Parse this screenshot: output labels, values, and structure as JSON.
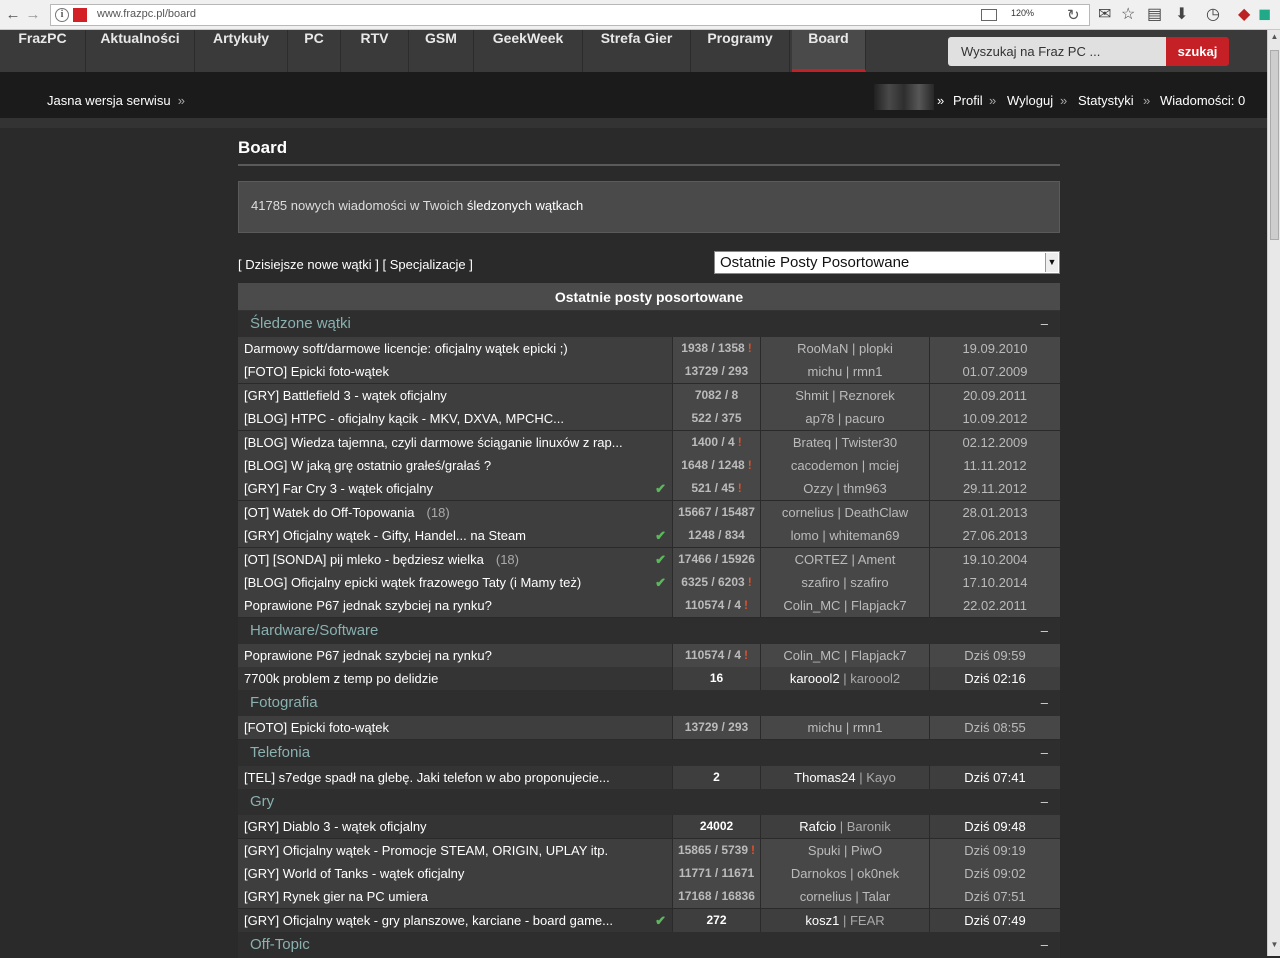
{
  "browser": {
    "url": "www.frazpc.pl/board",
    "zoom": "120%"
  },
  "nav": {
    "items": [
      "FrazPC",
      "Aktualności",
      "Artykuły",
      "PC",
      "RTV",
      "GSM",
      "GeekWeek",
      "Strefa Gier",
      "Programy",
      "Board"
    ],
    "active": "Board",
    "search_placeholder": "Wyszukaj na Fraz PC ...",
    "search_button": "szukaj"
  },
  "subbar": {
    "light_version": "Jasna wersja serwisu",
    "profile": "Profil",
    "logout": "Wyloguj",
    "stats": "Statystyki",
    "messages": "Wiadomości: 0",
    "separator": "»"
  },
  "board": {
    "title": "Board",
    "new_count": "41785",
    "new_text": "nowych wiadomości w Twoich",
    "followed_link": "śledzonych wątkach",
    "todays_link": "Dzisiejsze nowe wątki",
    "spec_link": "Specjalizacje",
    "sort_select": "Ostatnie Posty Posortowane",
    "table_header": "Ostatnie posty posortowane"
  },
  "sections": [
    {
      "name": "Śledzone wątki",
      "rows": [
        {
          "title": "Darmowy soft/darmowe licencje: oficjalny wątek epicki ;)",
          "count": "1938 / 1358",
          "excl": true,
          "users": "RooMaN | plopki",
          "date": "19.09.2010"
        },
        {
          "title": "[FOTO] Epicki foto-wątek",
          "count": "13729 / 293",
          "users": "michu | rmn1",
          "date": "01.07.2009"
        },
        {
          "title": "[GRY] Battlefield 3 - wątek oficjalny",
          "count": "7082 / 8",
          "users": "Shmit | Reznorek",
          "date": "20.09.2011"
        },
        {
          "title": "[BLOG] HTPC - oficjalny kącik - MKV, DXVA, MPCHC...",
          "count": "522 / 375",
          "users": "ap78 | pacuro",
          "date": "10.09.2012"
        },
        {
          "title": "[BLOG] Wiedza tajemna, czyli darmowe ściąganie linuxów z rap...",
          "count": "1400 / 4",
          "excl": true,
          "users": "Brateq | Twister30",
          "date": "02.12.2009"
        },
        {
          "title": "[BLOG] W jaką grę ostatnio grałeś/grałaś ?",
          "count": "1648 / 1248",
          "excl": true,
          "users": "cacodemon | mciej",
          "date": "11.11.2012"
        },
        {
          "title": "[GRY] Far Cry 3 - wątek oficjalny",
          "check": true,
          "count": "521 / 45",
          "excl": true,
          "users": "Ozzy | thm963",
          "date": "29.11.2012"
        },
        {
          "title": "[OT] Watek do Off-Topowania",
          "pages": "(18)",
          "count": "15667 / 15487",
          "users": "cornelius | DeathClaw",
          "date": "28.01.2013"
        },
        {
          "title": "[GRY] Oficjalny wątek - Gifty, Handel... na Steam",
          "check": true,
          "count": "1248 / 834",
          "users": "lomo | whiteman69",
          "date": "27.06.2013"
        },
        {
          "title": "[OT] [SONDA] pij mleko - będziesz wielka",
          "pages": "(18)",
          "check": true,
          "count": "17466 / 15926",
          "users": "CORTEZ | Ament",
          "date": "19.10.2004"
        },
        {
          "title": "[BLOG] Oficjalny epicki wątek frazowego Taty (i Mamy też)",
          "check": true,
          "count": "6325 / 6203",
          "excl": true,
          "users": "szafiro | szafiro",
          "date": "17.10.2014"
        },
        {
          "title": "Poprawione P67 jednak szybciej na rynku?",
          "count": "110574 / 4",
          "excl": true,
          "users": "Colin_MC | Flapjack7",
          "date": "22.02.2011"
        }
      ]
    },
    {
      "name": "Hardware/Software",
      "rows": [
        {
          "title": "Poprawione P67 jednak szybciej na rynku?",
          "count": "110574 / 4",
          "excl": true,
          "users": "Colin_MC | Flapjack7",
          "date": "Dziś 09:59"
        },
        {
          "title": "7700k problem z temp po delidzie",
          "count": "16",
          "fresh": true,
          "user1": "karoool2",
          "user2": "karoool2",
          "date": "Dziś 02:16"
        }
      ]
    },
    {
      "name": "Fotografia",
      "rows": [
        {
          "title": "[FOTO] Epicki foto-wątek",
          "count": "13729 / 293",
          "users": "michu | rmn1",
          "date": "Dziś 08:55"
        }
      ]
    },
    {
      "name": "Telefonia",
      "rows": [
        {
          "title": "[TEL] s7edge spadł na glebę. Jaki telefon w abo proponujecie...",
          "count": "2",
          "fresh": true,
          "user1": "Thomas24",
          "user2": "Kayo",
          "date": "Dziś 07:41"
        }
      ]
    },
    {
      "name": "Gry",
      "rows": [
        {
          "title": "[GRY] Diablo 3 - wątek oficjalny",
          "count": "24002",
          "fresh": true,
          "user1": "Rafcio",
          "user2": "Baronik",
          "date": "Dziś 09:48"
        },
        {
          "title": "[GRY] Oficjalny wątek - Promocje STEAM, ORIGIN, UPLAY itp.",
          "count": "15865 / 5739",
          "excl": true,
          "users": "Spuki | PiwO",
          "date": "Dziś 09:19"
        },
        {
          "title": "[GRY] World of Tanks - wątek oficjalny",
          "count": "11771 / 11671",
          "users": "Darnokos | ok0nek",
          "date": "Dziś 09:02"
        },
        {
          "title": "[GRY] Rynek gier na PC umiera",
          "count": "17168 / 16836",
          "users": "cornelius | Talar",
          "date": "Dziś 07:51"
        },
        {
          "title": "[GRY] Oficjalny wątek - gry planszowe, karciane - board game...",
          "check": true,
          "count": "272",
          "fresh": true,
          "user1": "kosz1",
          "user2": "FEAR",
          "date": "Dziś 07:49"
        }
      ]
    },
    {
      "name": "Off-Topic",
      "rows": []
    }
  ],
  "ui": {
    "collapse": "–",
    "check_glyph": "✔",
    "excl_glyph": "!"
  }
}
